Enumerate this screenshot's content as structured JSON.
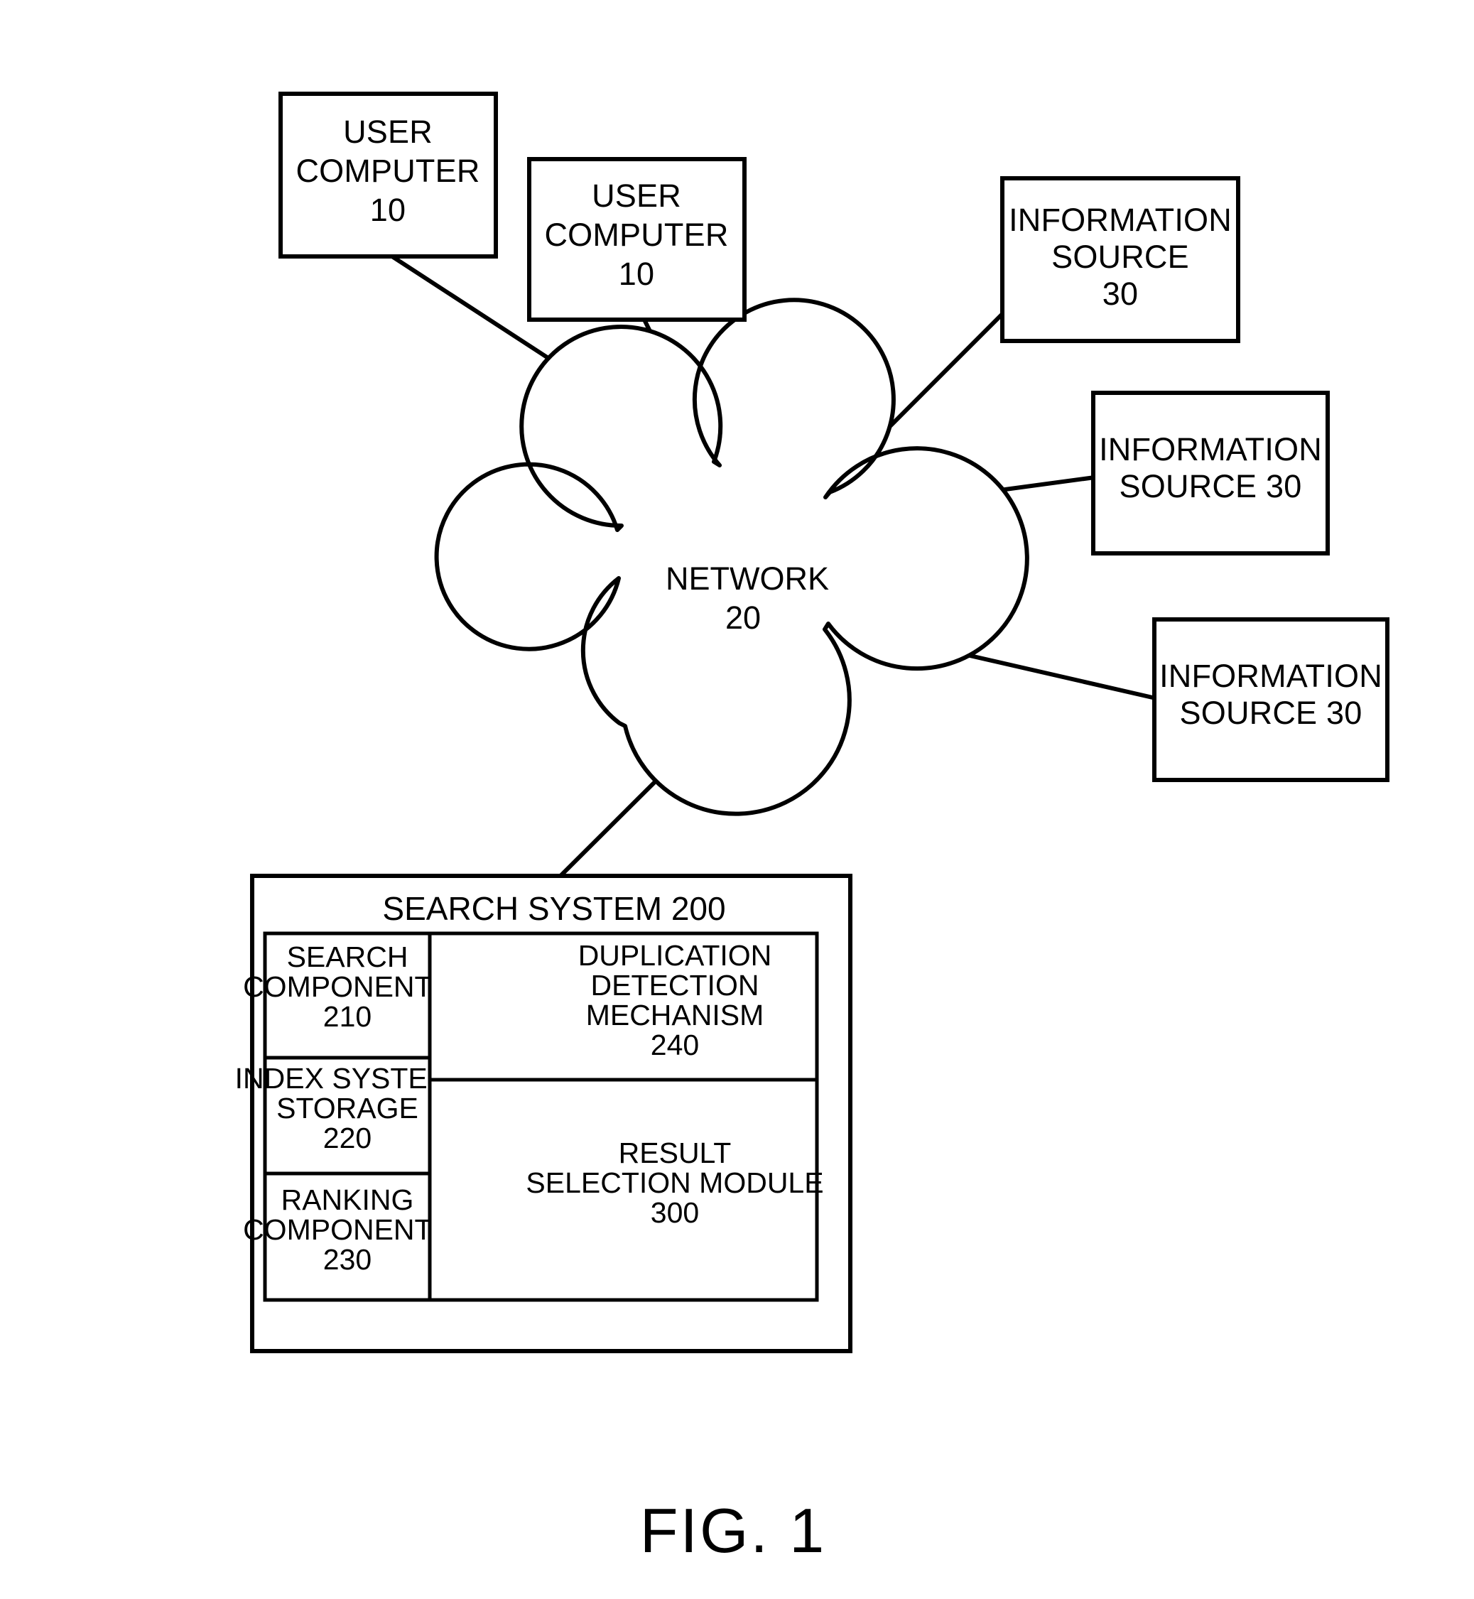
{
  "figure": {
    "caption": "FIG. 1",
    "nodes": {
      "user_computer_1": {
        "line1": "USER",
        "line2": "COMPUTER",
        "line3": "10"
      },
      "user_computer_2": {
        "line1": "USER",
        "line2": "COMPUTER",
        "line3": "10"
      },
      "information_source_1": {
        "line1": "INFORMATION",
        "line2": "SOURCE",
        "line3": "30"
      },
      "information_source_2": {
        "line1": "INFORMATION",
        "line2": "SOURCE 30"
      },
      "information_source_3": {
        "line1": "INFORMATION",
        "line2": "SOURCE 30"
      },
      "network_cloud": {
        "line1": "NETWORK",
        "line2": "20"
      },
      "search_system": {
        "title": "SEARCH SYSTEM 200",
        "modules": [
          {
            "name": "search-components",
            "lines": [
              "SEARCH",
              "COMPONENTS",
              "210"
            ]
          },
          {
            "name": "index-system-storage",
            "lines": [
              "INDEX SYSTEM/",
              "STORAGE",
              "220"
            ]
          },
          {
            "name": "ranking-components",
            "lines": [
              "RANKING",
              "COMPONENTS",
              "230"
            ]
          },
          {
            "name": "duplication-detection-mechanism",
            "lines": [
              "DUPLICATION",
              "DETECTION",
              "MECHANISM",
              "240"
            ]
          },
          {
            "name": "result-selection-module",
            "lines": [
              "RESULT",
              "SELECTION MODULE",
              "300"
            ]
          }
        ]
      }
    },
    "colors": {
      "stroke": "#000000",
      "fill": "#ffffff",
      "text": "#000000"
    }
  }
}
